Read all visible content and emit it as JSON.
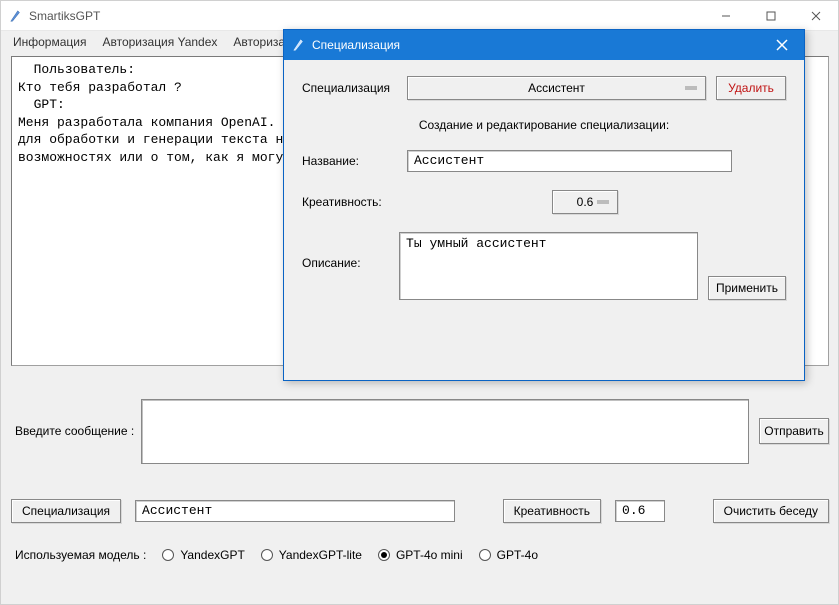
{
  "window": {
    "title": "SmartiksGPT"
  },
  "menubar": {
    "items": [
      "Информация",
      "Авторизация Yandex",
      "Авторизац"
    ]
  },
  "chat": {
    "text": "  Пользователь:\nКто тебя разработал ?\n  GPT:\nМеня разработала компания OpenAI.                                                                на\nдля обработки и генерации текста н\nвозможностях или о том, как я могу"
  },
  "input": {
    "label": "Введите сообщение :",
    "send": "Отправить"
  },
  "controls": {
    "spec_btn": "Специализация",
    "spec_value": "Ассистент",
    "creativity_btn": "Креативность",
    "creativity_value": "0.6",
    "clear_btn": "Очистить беседу"
  },
  "model": {
    "label": "Используемая модель :",
    "options": [
      "YandexGPT",
      "YandexGPT-lite",
      "GPT-4o mini",
      "GPT-4o"
    ],
    "selected": "GPT-4o mini"
  },
  "dialog": {
    "title": "Специализация",
    "spec_label": "Специализация",
    "spec_selected": "Ассистент",
    "delete_btn": "Удалить",
    "subtitle": "Создание и редактирование  специализации:",
    "name_label": "Название:",
    "name_value": "Ассистент",
    "creativity_label": "Креативность:",
    "creativity_value": "0.6",
    "desc_label": "Описание:",
    "desc_value": "Ты умный ассистент",
    "apply_btn": "Применить"
  }
}
